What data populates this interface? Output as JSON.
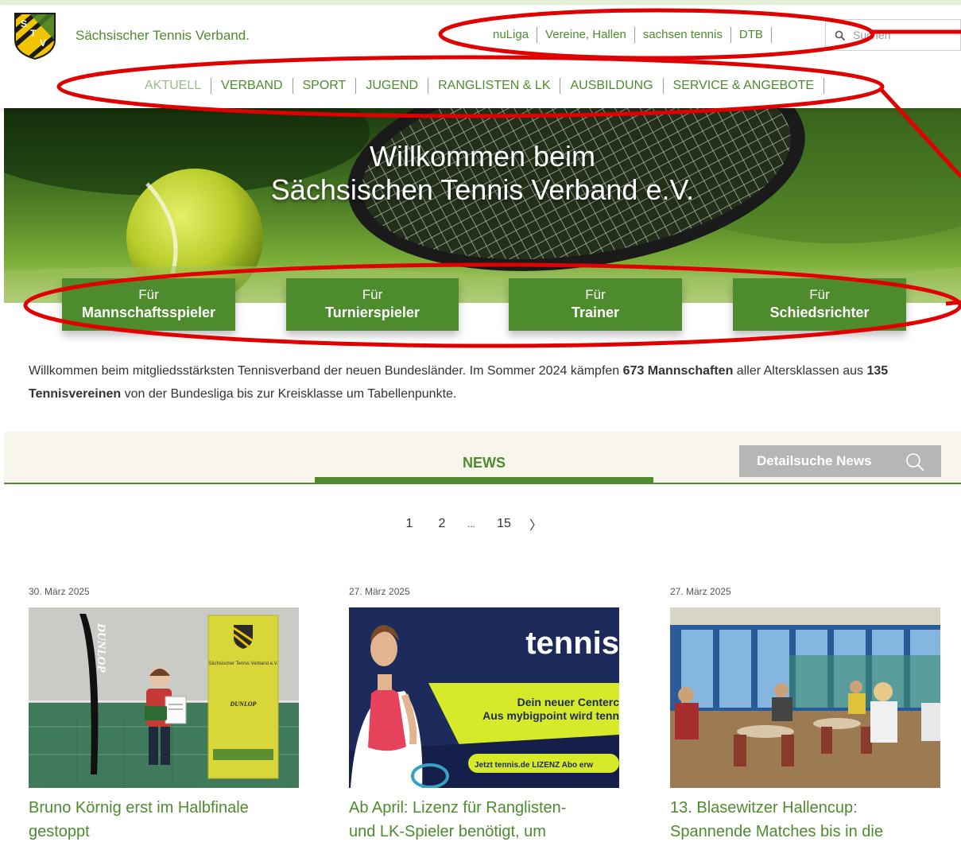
{
  "site": {
    "name": "Sächsischer Tennis Verband.",
    "logo_letters": [
      "S",
      "T",
      "V"
    ]
  },
  "topnav": {
    "items": [
      "nuLiga",
      "Vereine, Hallen",
      "sachsen tennis",
      "DTB",
      ""
    ]
  },
  "search": {
    "placeholder": "Suchen"
  },
  "mainnav": {
    "items": [
      "AKTUELL",
      "VERBAND",
      "SPORT",
      "JUGEND",
      "RANGLISTEN & LK",
      "AUSBILDUNG",
      "SERVICE & ANGEBOTE"
    ],
    "active": "AKTUELL"
  },
  "hero": {
    "title_line1": "Willkommen beim",
    "title_line2": "Sächsischen Tennis Verband e.V."
  },
  "categories": [
    {
      "line1": "Für",
      "line2": "Mannschaftsspieler"
    },
    {
      "line1": "Für",
      "line2": "Turnierspieler"
    },
    {
      "line1": "Für",
      "line2": "Trainer"
    },
    {
      "line1": "Für",
      "line2": "Schiedsrichter"
    }
  ],
  "intro": {
    "part1": "Willkommen beim mitgliedsstärksten Tennisverband der neuen Bundesländer. Im Sommer 2024 kämpfen ",
    "teams": "673 Mannschaften",
    "part2": " aller Altersklassen aus ",
    "clubs": "135 Tennisvereinen",
    "part3": " von der Bundesliga bis zur Kreisklasse um Tabellenpunkte."
  },
  "news": {
    "tab_label": "NEWS",
    "detail_search": "Detailsuche News"
  },
  "pagination": {
    "pages": [
      "1",
      "2",
      "...",
      "15"
    ],
    "next": "〉"
  },
  "cards": [
    {
      "date": "30. März 2025",
      "title_line1": "Bruno Körnig erst im Halbfinale",
      "title_line2": "gestoppt",
      "banner_left": "DUNLOP",
      "banner_right_text": "Sächsischer Tennis Verband e.V.",
      "banner_right_brand": "DUNLOP"
    },
    {
      "date": "27. März 2025",
      "title_line1": "Ab April: Lizenz für Ranglisten-",
      "title_line2": "und LK-Spieler benötigt, um",
      "ad_brand": "tennis",
      "ad_line1": "Dein neuer Centerc",
      "ad_line2": "Aus mybigpoint wird tenn",
      "ad_cta": "Jetzt tennis.de LIZENZ Abo erw"
    },
    {
      "date": "27. März 2025",
      "title_line1": "13. Blasewitzer Hallencup:",
      "title_line2": "Spannende Matches bis in die"
    }
  ],
  "colors": {
    "brand_green": "#4e8b2e",
    "annotation_red": "#e00000",
    "detail_button_gray": "#b6b6b6"
  }
}
